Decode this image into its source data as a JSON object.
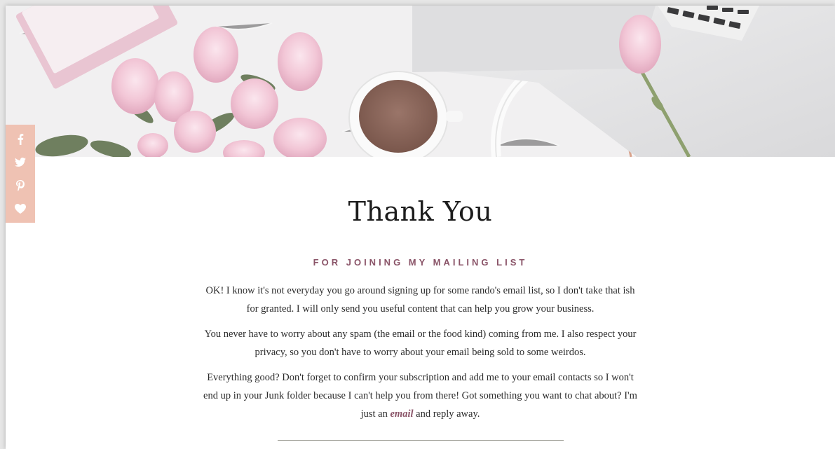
{
  "hero": {
    "icons": [
      "notebook-icon",
      "roses-icon",
      "coffee-cup-icon",
      "headphones-icon",
      "laptop-icon"
    ]
  },
  "social": {
    "items": [
      {
        "name": "facebook-icon",
        "glyph": "f"
      },
      {
        "name": "twitter-icon",
        "glyph": "bird"
      },
      {
        "name": "pinterest-icon",
        "glyph": "p"
      },
      {
        "name": "heart-icon",
        "glyph": "heart"
      }
    ],
    "color": "#efc2b3"
  },
  "main": {
    "title": "Thank You",
    "subtitle": "FOR JOINING MY MAILING LIST",
    "paragraph1": "OK! I know it's not everyday you go around signing up for some rando's email list, so I don't take that ish for granted. I will only send you useful content that can help you grow your business.",
    "paragraph2": "You never have to worry about any spam (the email or the food kind) coming from me. I also respect your privacy, so you don't have to worry about your email being sold to some weirdos.",
    "paragraph3_before": "Everything good? Don't forget to confirm your subscription and add me to your email contacts so I won't end up in your Junk folder because I can't help you from there! Got something you want to chat about? I'm just an ",
    "paragraph3_link": "email",
    "paragraph3_after": " and reply away."
  },
  "colors": {
    "accent": "#8a5468",
    "social_bg": "#efc2b3",
    "divider": "#8f8f85"
  }
}
